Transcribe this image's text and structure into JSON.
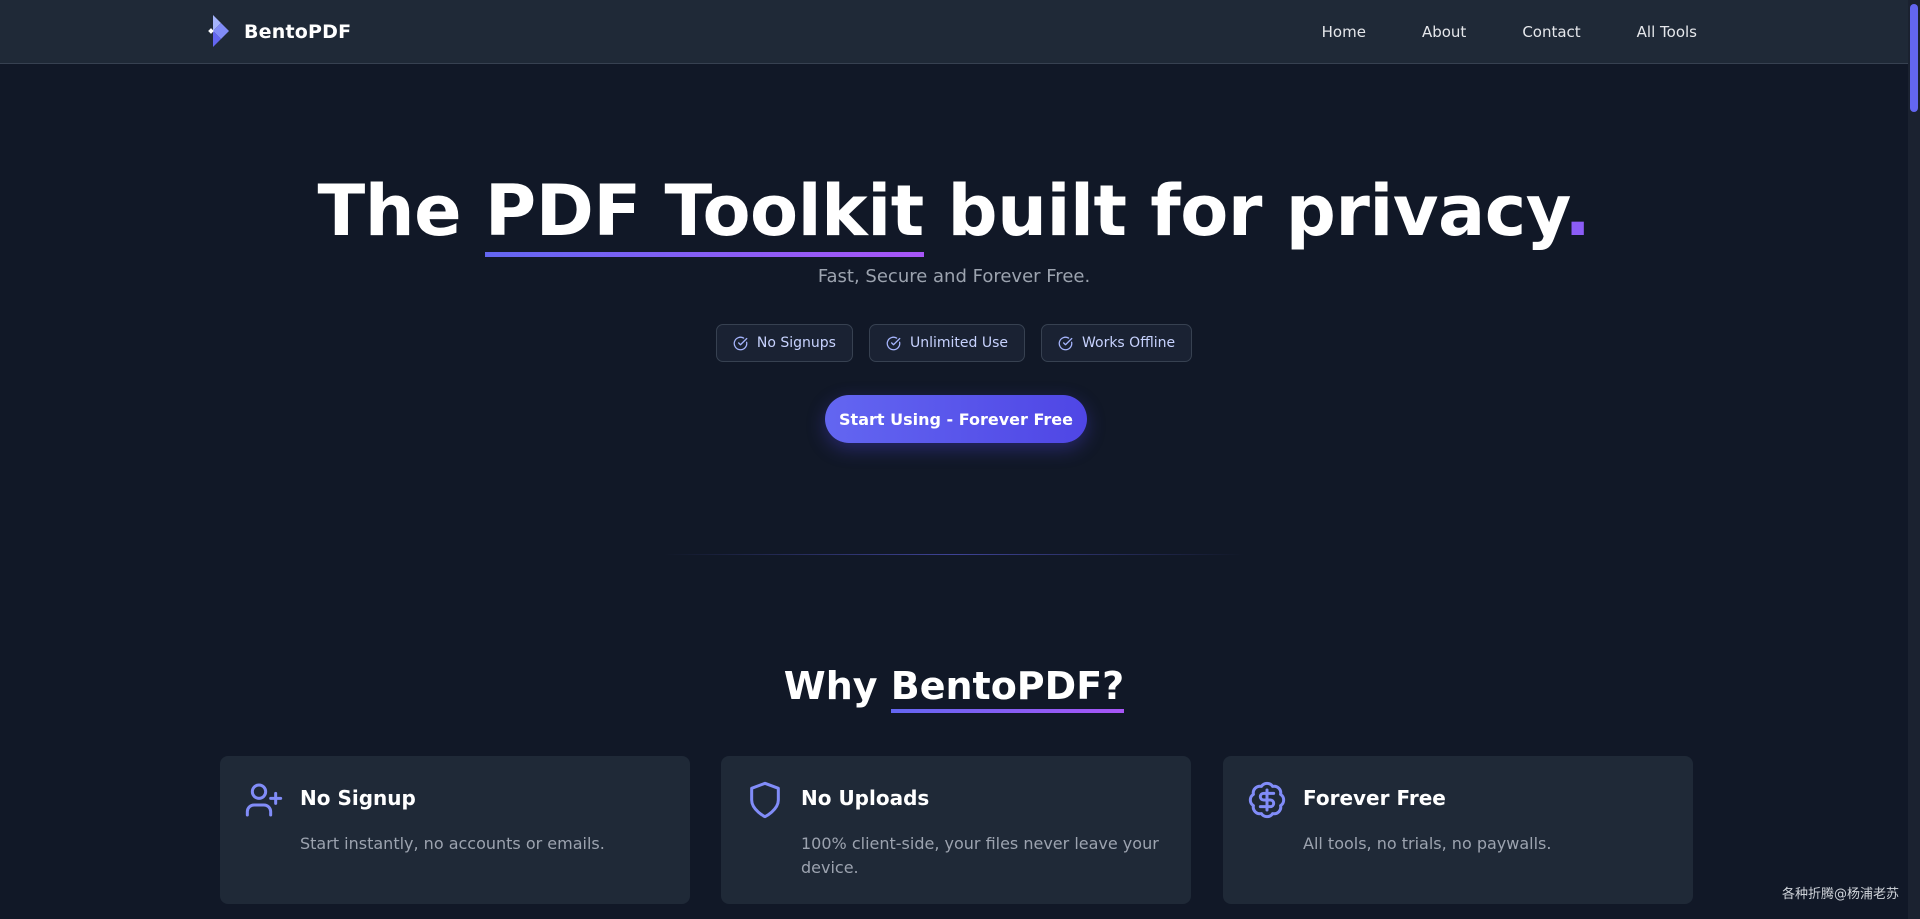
{
  "brand": {
    "name": "BentoPDF"
  },
  "nav": {
    "items": [
      {
        "label": "Home"
      },
      {
        "label": "About"
      },
      {
        "label": "Contact"
      },
      {
        "label": "All Tools"
      }
    ]
  },
  "hero": {
    "title_pre": "The ",
    "title_highlight": "PDF Toolkit",
    "title_post": " built for privacy",
    "title_dot": ".",
    "subtitle": "Fast, Secure and Forever Free.",
    "badges": [
      {
        "label": "No Signups",
        "icon": "check-circle-icon"
      },
      {
        "label": "Unlimited Use",
        "icon": "check-circle-icon"
      },
      {
        "label": "Works Offline",
        "icon": "check-circle-icon"
      }
    ],
    "cta_label": "Start Using - Forever Free"
  },
  "why": {
    "title_pre": "Why ",
    "title_highlight": "BentoPDF?",
    "cards": [
      {
        "icon": "user-plus-icon",
        "title": "No Signup",
        "description": "Start instantly, no accounts or emails."
      },
      {
        "icon": "shield-icon",
        "title": "No Uploads",
        "description": "100% client-side, your files never leave your device."
      },
      {
        "icon": "badge-dollar-icon",
        "title": "Forever Free",
        "description": "All tools, no trials, no paywalls."
      }
    ]
  },
  "watermark": "各种折腾@杨浦老苏",
  "colors": {
    "background": "#111827",
    "nav_background": "#1f2937",
    "card_background": "#1f2937",
    "accent": "#6366f1",
    "accent_purple": "#8b5cf6",
    "muted_text": "#9ca3af"
  }
}
